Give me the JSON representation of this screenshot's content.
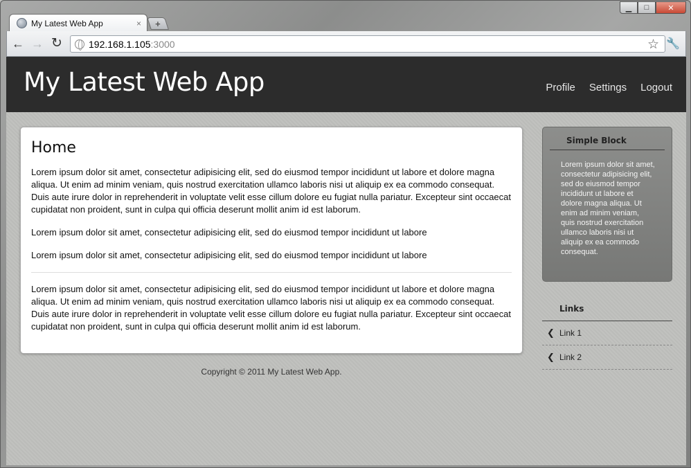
{
  "browser": {
    "tab_title": "My Latest Web App",
    "tab_close": "×",
    "new_tab": "+",
    "url_host": "192.168.1.105",
    "url_port": ":3000",
    "window_controls": {
      "minimize": "▁",
      "maximize": "□",
      "close": "✕"
    },
    "icons": {
      "back": "←",
      "forward": "→",
      "reload": "↻",
      "bookmark": "☆",
      "wrench": "🔧"
    }
  },
  "header": {
    "title": "My Latest Web App",
    "nav": [
      "Profile",
      "Settings",
      "Logout"
    ]
  },
  "main": {
    "heading": "Home",
    "paragraphs": [
      "Lorem ipsum dolor sit amet, consectetur adipisicing elit, sed do eiusmod tempor incididunt ut labore et dolore magna aliqua. Ut enim ad minim veniam, quis nostrud exercitation ullamco laboris nisi ut aliquip ex ea commodo consequat. Duis aute irure dolor in reprehenderit in voluptate velit esse cillum dolore eu fugiat nulla pariatur. Excepteur sint occaecat cupidatat non proident, sunt in culpa qui officia deserunt mollit anim id est laborum.",
      "Lorem ipsum dolor sit amet, consectetur adipisicing elit, sed do eiusmod tempor incididunt ut labore",
      "Lorem ipsum dolor sit amet, consectetur adipisicing elit, sed do eiusmod tempor incididunt ut labore",
      "Lorem ipsum dolor sit amet, consectetur adipisicing elit, sed do eiusmod tempor incididunt ut labore et dolore magna aliqua. Ut enim ad minim veniam, quis nostrud exercitation ullamco laboris nisi ut aliquip ex ea commodo consequat. Duis aute irure dolor in reprehenderit in voluptate velit esse cillum dolore eu fugiat nulla pariatur. Excepteur sint occaecat cupidatat non proident, sunt in culpa qui officia deserunt mollit anim id est laborum."
    ]
  },
  "footer": {
    "copyright": "Copyright © 2011 My Latest Web App."
  },
  "sidebar": {
    "simple_block": {
      "title": "Simple Block",
      "text": "Lorem ipsum dolor sit amet, consectetur adipisicing elit, sed do eiusmod tempor incididunt ut labore et dolore magna aliqua. Ut enim ad minim veniam, quis nostrud exercitation ullamco laboris nisi ut aliquip ex ea commodo consequat."
    },
    "links": {
      "title": "Links",
      "chevron": "❮",
      "items": [
        "Link 1",
        "Link 2"
      ]
    }
  },
  "colors": {
    "header_bg": "#2c2c2c",
    "page_bg": "#bfc0bd",
    "simple_block_bg": "#848583"
  }
}
